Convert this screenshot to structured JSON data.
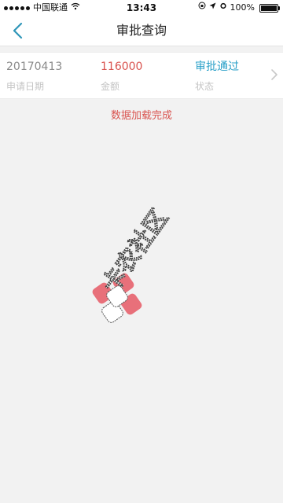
{
  "status_bar": {
    "carrier": "中国联通",
    "time": "13:43",
    "battery": "100%",
    "battery_level": 1.0
  },
  "nav": {
    "title": "审批查询",
    "back_icon": "chevron-left-icon"
  },
  "record": {
    "date": "20170413",
    "date_label": "申请日期",
    "amount": "116000",
    "amount_label": "金额",
    "status": "审批通过",
    "status_label": "状态"
  },
  "load_status": "数据加载完成",
  "watermark": {
    "text": "卡农社区"
  },
  "colors": {
    "accent": "#2e96b8",
    "amount": "#d9534f",
    "status": "#2aa0c8",
    "background": "#f2f2f2"
  }
}
